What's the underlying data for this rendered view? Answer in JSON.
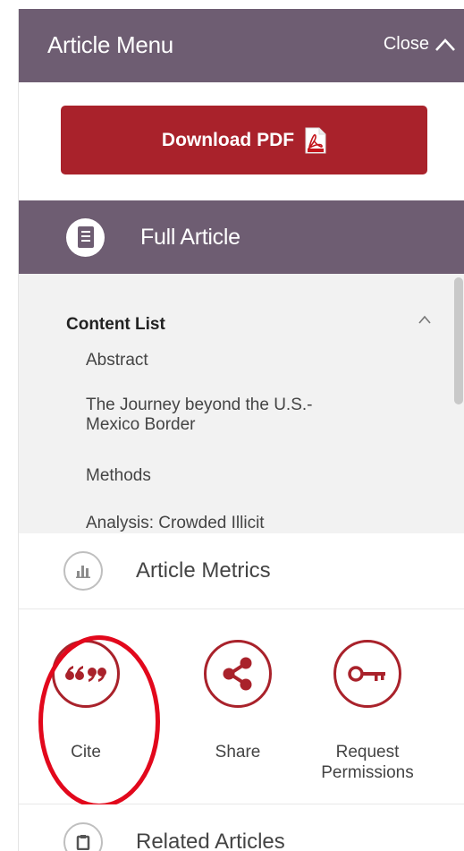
{
  "header": {
    "title": "Article Menu",
    "close_label": "Close"
  },
  "download": {
    "label": "Download PDF",
    "icon": "pdf-file-icon"
  },
  "full_article": {
    "label": "Full Article",
    "icon": "document-icon"
  },
  "content_list": {
    "title": "Content List",
    "items": [
      "Abstract",
      "The Journey beyond the U.S.-\nMexico Border",
      "Methods",
      "Analysis: Crowded Illicit"
    ]
  },
  "metrics": {
    "label": "Article Metrics",
    "icon": "bar-chart-icon"
  },
  "actions": [
    {
      "label": "Cite",
      "icon": "quote-icon"
    },
    {
      "label": "Share",
      "icon": "share-icon"
    },
    {
      "label": "Request\nPermissions",
      "icon": "key-icon"
    }
  ],
  "related": {
    "label": "Related Articles",
    "icon": "clipboard-icon"
  },
  "colors": {
    "header_purple": "#6e5d72",
    "brand_red": "#a9222b",
    "highlight_red": "#e2081c"
  }
}
